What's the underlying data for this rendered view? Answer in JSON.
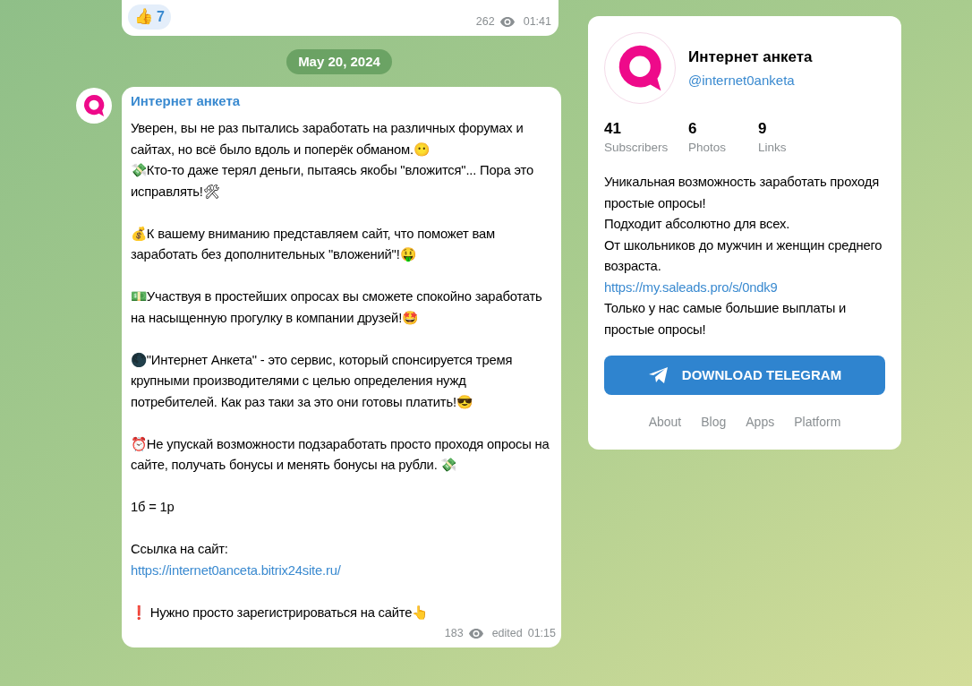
{
  "previous_message": {
    "reaction": {
      "emoji": "👍",
      "count": "7"
    },
    "views": "262",
    "time": "01:41"
  },
  "date_separator": "May 20, 2024",
  "message": {
    "author": "Интернет анкета",
    "paragraphs": [
      [
        {
          "kind": "text",
          "text": "Уверен, вы не раз пытались заработать на различных форумах и сайтах, но всё было вдоль и поперёк обманом.😶"
        },
        {
          "kind": "text",
          "text": "💸Кто-то даже терял деньги, пытаясь якобы \"вложится\"... Пора это исправлять!🛠"
        }
      ],
      [
        {
          "kind": "text",
          "text": "💰К вашему вниманию представляем сайт, что поможет вам заработать без дополнительных \"вложений\"!🤑"
        }
      ],
      [
        {
          "kind": "text",
          "text": "💵Участвуя в простейших опросах вы сможете спокойно заработать на насыщенную прогулку в компании друзей!🤩"
        }
      ],
      [
        {
          "kind": "text",
          "text": "🌑\"Интернет Анкета\" - это сервис, который спонсируется тремя крупными производителями с целью определения нужд потребителей. Как раз таки за это они готовы платить!😎"
        }
      ],
      [
        {
          "kind": "text",
          "text": "⏰Не упускай возможности подзаработать просто проходя опросы на сайте, получать бонусы и менять бонусы на рубли. 💸"
        }
      ],
      [
        {
          "kind": "text",
          "text": "1б = 1р"
        }
      ],
      [
        {
          "kind": "text",
          "text": "Ссылка на сайт:"
        },
        {
          "kind": "link",
          "text": "https://internet0anceta.bitrix24site.ru/"
        }
      ],
      [
        {
          "kind": "text",
          "text": "❗ Нужно просто зарегистрироваться на сайте👆"
        }
      ]
    ],
    "views": "183",
    "edited": "edited",
    "time": "01:15"
  },
  "channel_card": {
    "title": "Интернет анкета",
    "handle": "@internet0anketa",
    "stats": [
      {
        "value": "41",
        "label": "Subscribers"
      },
      {
        "value": "6",
        "label": "Photos"
      },
      {
        "value": "9",
        "label": "Links"
      }
    ],
    "description": [
      {
        "kind": "text",
        "text": "Уникальная возможность заработать проходя простые опросы!"
      },
      {
        "kind": "text",
        "text": "Подходит абсолютно для всех."
      },
      {
        "kind": "text",
        "text": "От школьников до мужчин и женщин среднего возраста."
      },
      {
        "kind": "link",
        "text": "https://my.saleads.pro/s/0ndk9"
      },
      {
        "kind": "text",
        "text": "Только у нас самые большие выплаты и простые опросы!"
      }
    ],
    "button": "DOWNLOAD TELEGRAM",
    "footer_links": [
      "About",
      "Blog",
      "Apps",
      "Platform"
    ]
  }
}
